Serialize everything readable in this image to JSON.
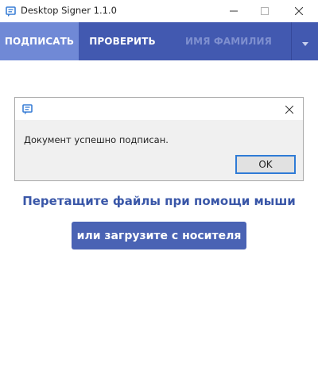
{
  "window": {
    "title": "Desktop Signer 1.1.0",
    "icon": "document-chat-icon",
    "controls": [
      "minimize-icon",
      "maximize-icon",
      "close-icon"
    ]
  },
  "nav": {
    "tabs": [
      {
        "label": "ПОДПИСАТЬ",
        "active": true
      },
      {
        "label": "ПРОВЕРИТЬ",
        "active": false
      },
      {
        "label": "ИМЯ ФАМИЛИЯ",
        "active": false
      }
    ],
    "dropdown_icon": "chevron-down-icon"
  },
  "dialog": {
    "icon": "document-chat-icon",
    "message": "Документ успешно подписан.",
    "ok_label": "OK"
  },
  "main": {
    "drop_hint": "Перетащите файлы при помощи мыши",
    "upload_label": "или загрузите с носителя"
  },
  "colors": {
    "nav_bg": "#4259b0",
    "nav_active": "#7089d6",
    "accent_text": "#3a57a8",
    "button_bg": "#4a63b4",
    "focus_border": "#2f7bd6"
  }
}
